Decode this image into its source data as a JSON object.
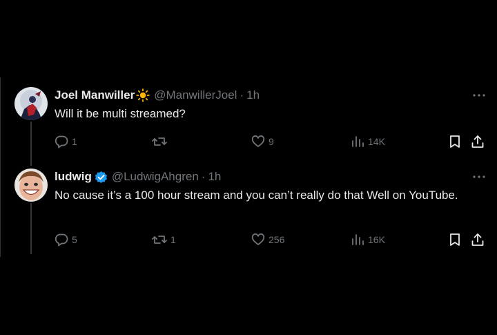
{
  "tweets": [
    {
      "name": "Joel Manwiller",
      "emoji": "sun-emoji",
      "handle": "@ManwillerJoel",
      "separator": "·",
      "time": "1h",
      "text": "Will it be multi streamed?",
      "replies": "1",
      "retweets": "",
      "likes": "9",
      "views": "14K"
    },
    {
      "name": "ludwig",
      "verified": true,
      "handle": "@LudwigAhgren",
      "separator": "·",
      "time": "1h",
      "text": "No cause it’s a 100 hour stream and you can’t really do that Well on YouTube.",
      "replies": "5",
      "retweets": "1",
      "likes": "256",
      "views": "16K"
    }
  ],
  "colors": {
    "background": "#000000",
    "text": "#e7e9ea",
    "muted": "#71767b",
    "verified": "#1d9bf0",
    "divider": "#2f3336"
  }
}
